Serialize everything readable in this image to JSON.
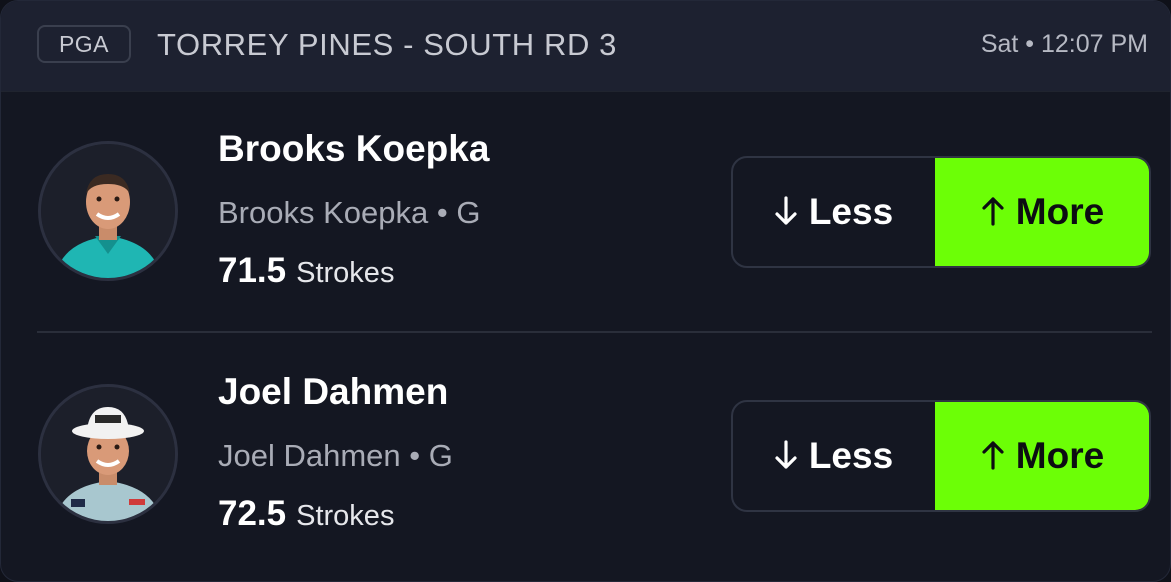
{
  "header": {
    "league": "PGA",
    "match": "TORREY PINES - SOUTH RD 3",
    "time": "Sat • 12:07 PM"
  },
  "players": [
    {
      "name": "Brooks Koepka",
      "subtitle": "Brooks Koepka • G",
      "line": "71.5",
      "stat": "Strokes",
      "less_label": "Less",
      "more_label": "More",
      "selected": "more"
    },
    {
      "name": "Joel Dahmen",
      "subtitle": "Joel Dahmen • G",
      "line": "72.5",
      "stat": "Strokes",
      "less_label": "Less",
      "more_label": "More",
      "selected": "more"
    }
  ],
  "colors": {
    "accent": "#6cff06",
    "background": "#141722",
    "header": "#1d2130"
  },
  "icons": {
    "less": "arrow-down-icon",
    "more": "arrow-up-icon"
  }
}
